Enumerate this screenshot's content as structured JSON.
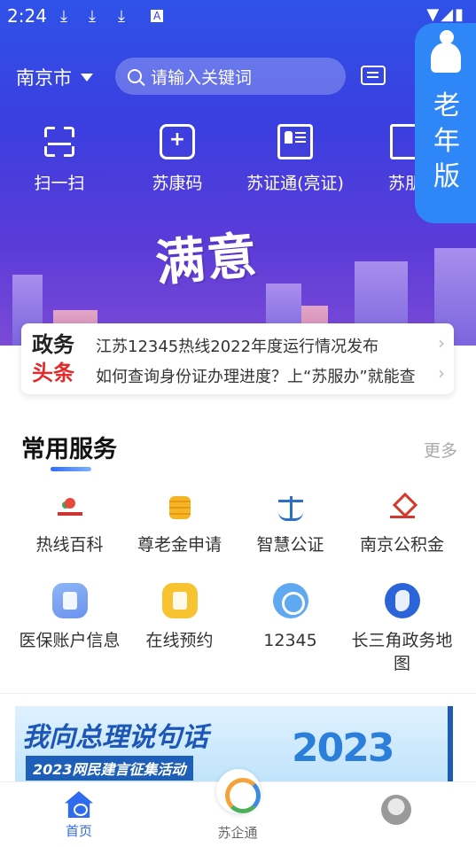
{
  "status_bar": {
    "time": "2:24",
    "downloads": [
      "⤓",
      "⤓",
      "⤓"
    ],
    "badge": "A",
    "right_icons": "▼◢▮"
  },
  "header": {
    "city": "南京市",
    "search_placeholder": "请输入关键词",
    "quick_actions": [
      {
        "label": "扫一扫",
        "icon": "scan-icon"
      },
      {
        "label": "苏康码",
        "icon": "health-code-icon"
      },
      {
        "label": "苏证通(亮证)",
        "icon": "id-card-icon"
      },
      {
        "label": "苏朋",
        "icon": "grid-icon"
      }
    ],
    "elder_mode": [
      "老",
      "年",
      "版"
    ],
    "banner_text": "满意"
  },
  "news": {
    "tag_line1": "政务",
    "tag_line2": "头条",
    "items": [
      "江苏12345热线2022年度运行情况发布",
      "如何查询身份证办理进度？上“苏服办”就能查"
    ]
  },
  "services": {
    "title": "常用服务",
    "more": "更多",
    "items": [
      {
        "label": "热线百科",
        "icon": "hotline-icon"
      },
      {
        "label": "尊老金申请",
        "icon": "coin-icon"
      },
      {
        "label": "智慧公证",
        "icon": "scale-icon"
      },
      {
        "label": "南京公积金",
        "icon": "fund-icon"
      },
      {
        "label": "医保账户信息",
        "icon": "medical-insurance-icon"
      },
      {
        "label": "在线预约",
        "icon": "appointment-icon"
      },
      {
        "label": "12345",
        "icon": "hotline-phone-icon"
      },
      {
        "label": "长三角政务地",
        "label2": "图",
        "icon": "map-icon"
      }
    ]
  },
  "promo": {
    "title": "我向总理说句话",
    "subtitle": "2023网民建言征集活动",
    "year": "2023"
  },
  "tabbar": {
    "home": "首页",
    "enterprise": "苏企通"
  },
  "colors": {
    "primary": "#2f6bf0",
    "hero_top": "#2f52e8",
    "hero_bottom": "#7b4ad6",
    "accent_red": "#e22a2a",
    "elder_blue": "#2f86f6"
  }
}
